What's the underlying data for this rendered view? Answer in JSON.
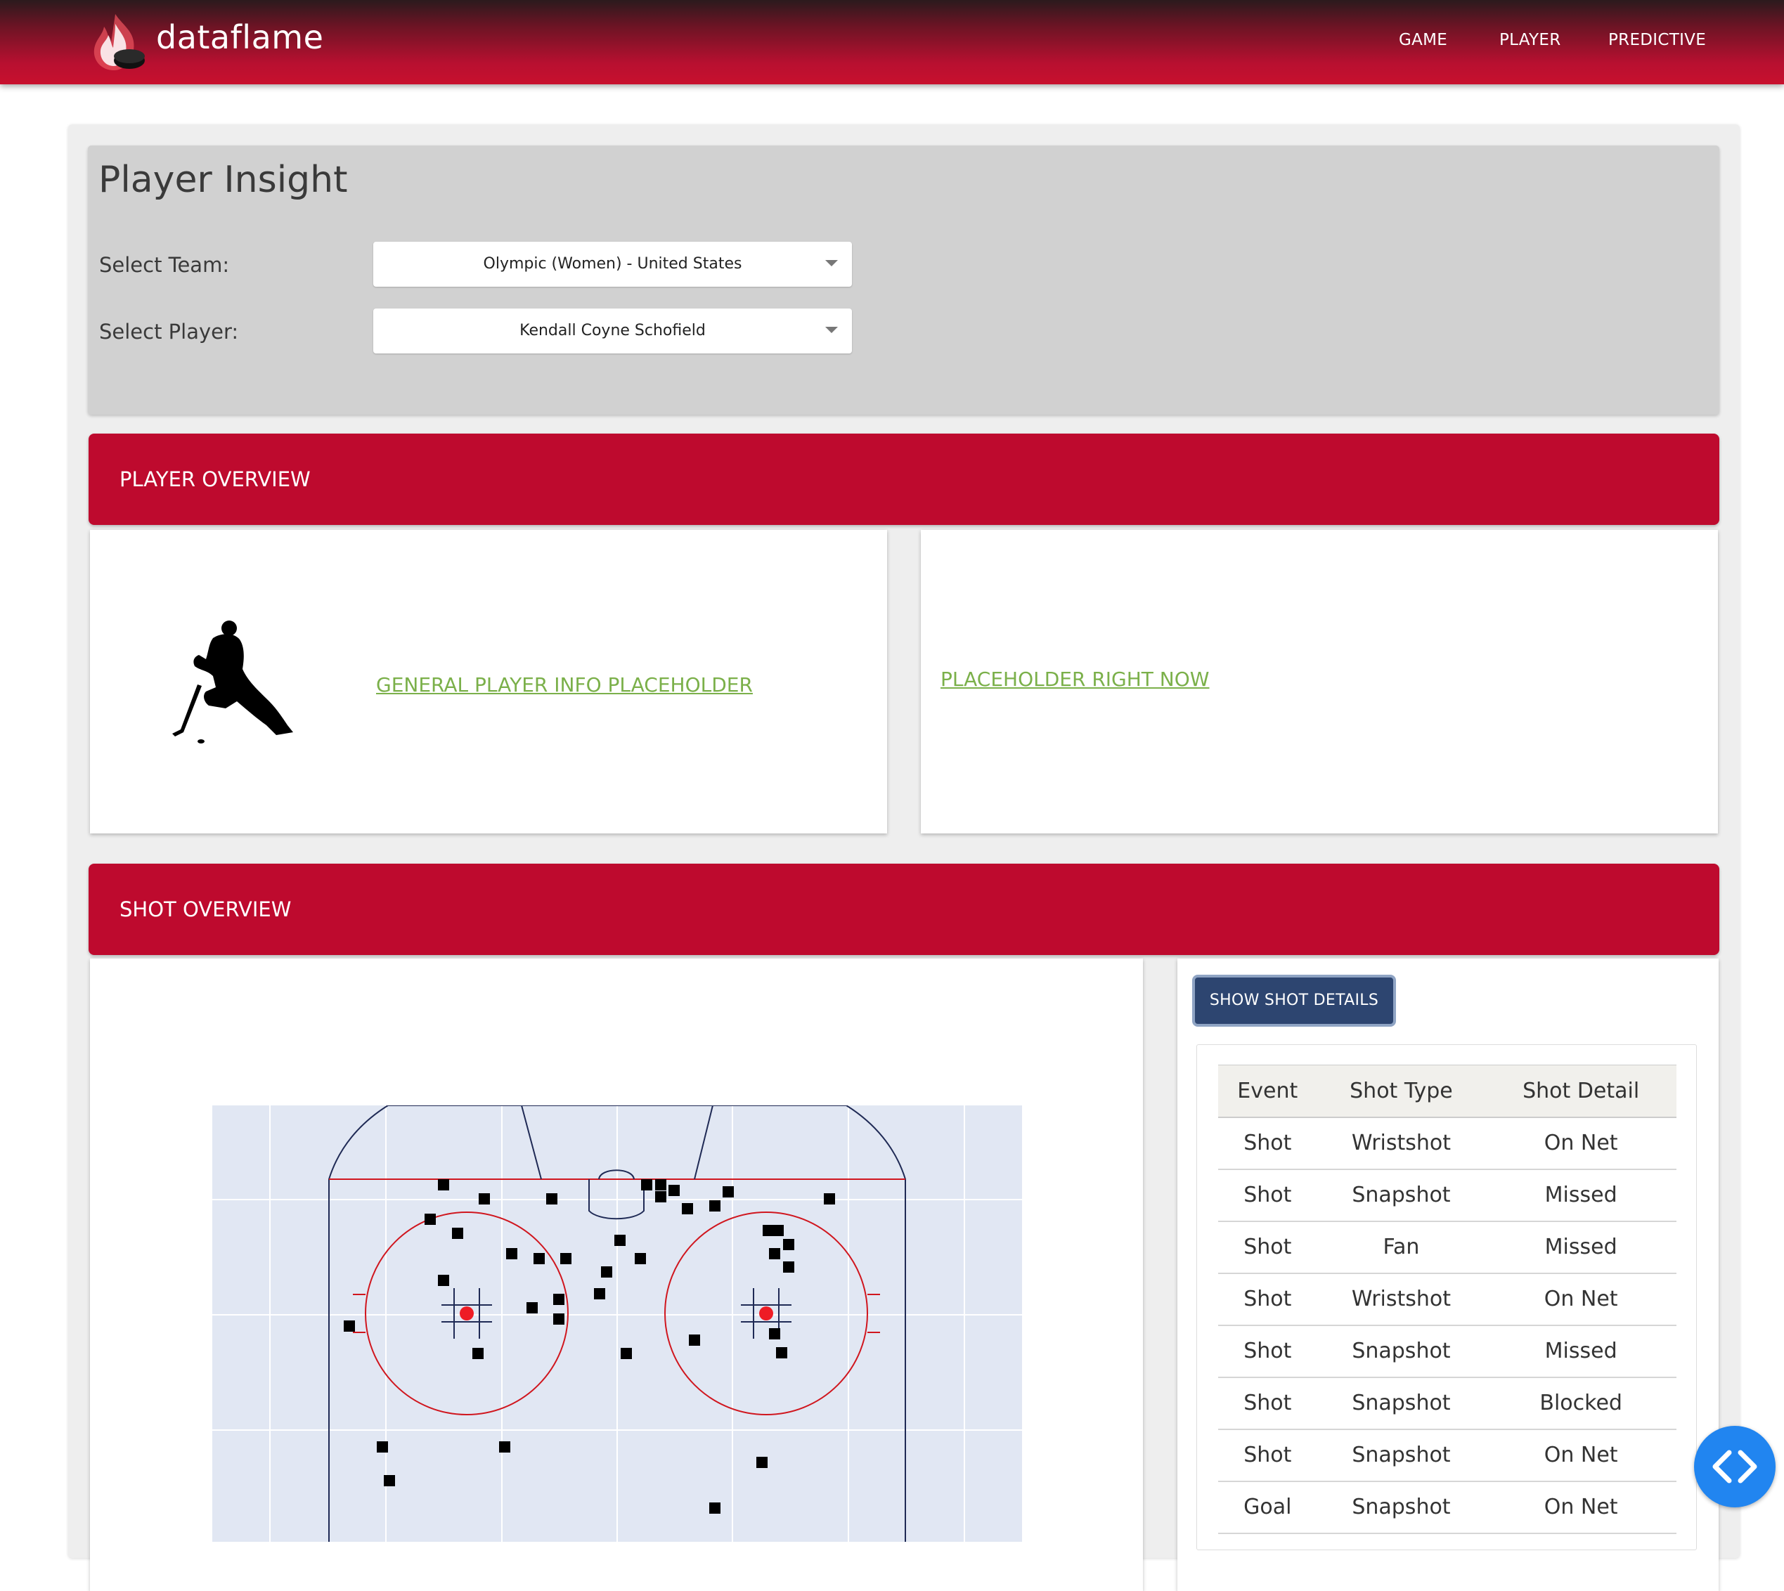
{
  "header": {
    "brand": "dataflame",
    "nav": [
      "GAME",
      "PLAYER",
      "PREDICTIVE"
    ]
  },
  "page": {
    "title": "Player Insight",
    "team_label": "Select Team:",
    "team_value": "Olympic (Women) - United States",
    "player_label": "Select Player:",
    "player_value": "Kendall Coyne Schofield"
  },
  "player_overview": {
    "title": "PLAYER OVERVIEW",
    "left_link": "GENERAL PLAYER INFO PLACEHOLDER",
    "right_link": "PLACEHOLDER RIGHT NOW"
  },
  "shot_overview": {
    "title": "SHOT OVERVIEW",
    "button": "SHOW SHOT DETAILS",
    "columns": [
      "Event",
      "Shot Type",
      "Shot Detail"
    ],
    "rows": [
      [
        "Shot",
        "Wristshot",
        "On Net"
      ],
      [
        "Shot",
        "Snapshot",
        "Missed"
      ],
      [
        "Shot",
        "Fan",
        "Missed"
      ],
      [
        "Shot",
        "Wristshot",
        "On Net"
      ],
      [
        "Shot",
        "Snapshot",
        "Missed"
      ],
      [
        "Shot",
        "Snapshot",
        "Blocked"
      ],
      [
        "Shot",
        "Snapshot",
        "On Net"
      ],
      [
        "Goal",
        "Snapshot",
        "On Net"
      ]
    ]
  },
  "colors": {
    "brand_red": "#be0a2e",
    "button_navy": "#2d4570",
    "link_green": "#7bb04a",
    "fab_blue": "#2185f0"
  },
  "icons": [
    "flame-puck-logo-icon",
    "hockey-player-silhouette-icon",
    "code-brackets-icon"
  ]
}
